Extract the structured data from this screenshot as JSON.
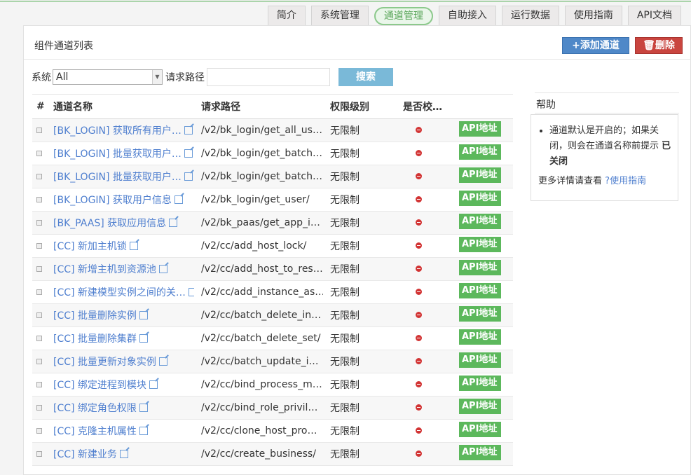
{
  "nav": {
    "tabs": [
      {
        "label": "简介"
      },
      {
        "label": "系统管理"
      },
      {
        "label": "通道管理"
      },
      {
        "label": "自助接入"
      },
      {
        "label": "运行数据"
      },
      {
        "label": "使用指南"
      },
      {
        "label": "API文档"
      }
    ],
    "active_tab": "通道管理"
  },
  "panel": {
    "title": "组件通道列表",
    "add_button": "+添加通道",
    "delete_button": "删除"
  },
  "filter": {
    "system_label": "系统",
    "system_value": "All",
    "path_label": "请求路径",
    "path_value": "",
    "search_button": "搜索"
  },
  "table": {
    "headers": [
      "#",
      "通道名称",
      "请求路径",
      "权限级别",
      "是否校…"
    ],
    "rows": [
      {
        "name": "[BK_LOGIN] 获取所有用户…",
        "path": "/v2/bk_login/get_all_us…",
        "level": "无限制",
        "api": "API地址"
      },
      {
        "name": "[BK_LOGIN] 批量获取用户…",
        "path": "/v2/bk_login/get_batch…",
        "level": "无限制",
        "api": "API地址"
      },
      {
        "name": "[BK_LOGIN] 批量获取用户…",
        "path": "/v2/bk_login/get_batch…",
        "level": "无限制",
        "api": "API地址"
      },
      {
        "name": "[BK_LOGIN] 获取用户信息",
        "path": "/v2/bk_login/get_user/",
        "level": "无限制",
        "api": "API地址"
      },
      {
        "name": "[BK_PAAS] 获取应用信息",
        "path": "/v2/bk_paas/get_app_i…",
        "level": "无限制",
        "api": "API地址"
      },
      {
        "name": "[CC] 新加主机锁",
        "path": "/v2/cc/add_host_lock/",
        "level": "无限制",
        "api": "API地址"
      },
      {
        "name": "[CC] 新增主机到资源池",
        "path": "/v2/cc/add_host_to_res…",
        "level": "无限制",
        "api": "API地址"
      },
      {
        "name": "[CC] 新建模型实例之间的关…",
        "path": "/v2/cc/add_instance_as…",
        "level": "无限制",
        "api": "API地址"
      },
      {
        "name": "[CC] 批量删除实例",
        "path": "/v2/cc/batch_delete_in…",
        "level": "无限制",
        "api": "API地址"
      },
      {
        "name": "[CC] 批量删除集群",
        "path": "/v2/cc/batch_delete_set/",
        "level": "无限制",
        "api": "API地址"
      },
      {
        "name": "[CC] 批量更新对象实例",
        "path": "/v2/cc/batch_update_i…",
        "level": "无限制",
        "api": "API地址"
      },
      {
        "name": "[CC] 绑定进程到模块",
        "path": "/v2/cc/bind_process_m…",
        "level": "无限制",
        "api": "API地址"
      },
      {
        "name": "[CC] 绑定角色权限",
        "path": "/v2/cc/bind_role_privil…",
        "level": "无限制",
        "api": "API地址"
      },
      {
        "name": "[CC] 克隆主机属性",
        "path": "/v2/cc/clone_host_pro…",
        "level": "无限制",
        "api": "API地址"
      },
      {
        "name": "[CC] 新建业务",
        "path": "/v2/cc/create_business/",
        "level": "无限制",
        "api": "API地址"
      }
    ]
  },
  "help": {
    "title": "帮助",
    "text": "通道默认是开启的；如果关闭，则会在通道名称前提示",
    "text_bold": "已关闭",
    "more_text": "更多详情请查看",
    "more_link": "使用指南"
  },
  "colors": {
    "accent_green": "#5cb85c",
    "link_blue": "#4f7fcf",
    "add_button": "#4f88c8",
    "delete_button": "#c9453f",
    "search_button": "#7ab9d8"
  }
}
